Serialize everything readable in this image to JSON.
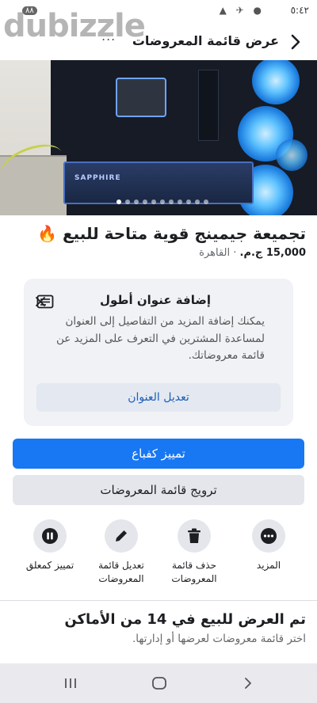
{
  "status_bar": {
    "time": "٥:٤٢",
    "notification_badge": "٨٨"
  },
  "watermark": {
    "text": "dubizzle",
    "overflow_dots": "..."
  },
  "header": {
    "title": "عرض قائمة المعروضات",
    "back_icon": "chevron-right-icon"
  },
  "hero": {
    "gpu_brand": "SAPPHIRE",
    "page_count": 11,
    "active_page": 0
  },
  "listing": {
    "title": "تجميعة جيمينج قوية متاحة للبيع 🔥",
    "price": "15,000 ج.م.",
    "location": "القاهرة",
    "separator": " · "
  },
  "tip_card": {
    "title": "إضافة عنوان أطول",
    "body": "يمكنك إضافة المزيد من التفاصيل إلى العنوان لمساعدة المشترين في التعرف على المزيد عن قائمة معروضاتك.",
    "button_label": "تعديل العنوان"
  },
  "buttons": {
    "primary_label": "تمييز كفباع",
    "secondary_label": "ترويج قائمة المعروضات"
  },
  "actions": [
    {
      "label": "المزيد",
      "icon": "more-icon"
    },
    {
      "label": "حذف قائمة المعروضات",
      "icon": "trash-icon"
    },
    {
      "label": "تعديل قائمة المعروضات",
      "icon": "pencil-icon"
    },
    {
      "label": "تمييز كمعلق",
      "icon": "pause-icon"
    }
  ],
  "footer": {
    "title": "تم العرض للبيع في 14 من الأماكن",
    "subtitle": "اختر قائمة معروضات لعرضها أو إدارتها."
  },
  "colors": {
    "primary": "#1877f2",
    "link": "#1b5fb8",
    "card_bg": "#f0f2f5",
    "button_gray": "#e4e6eb"
  }
}
